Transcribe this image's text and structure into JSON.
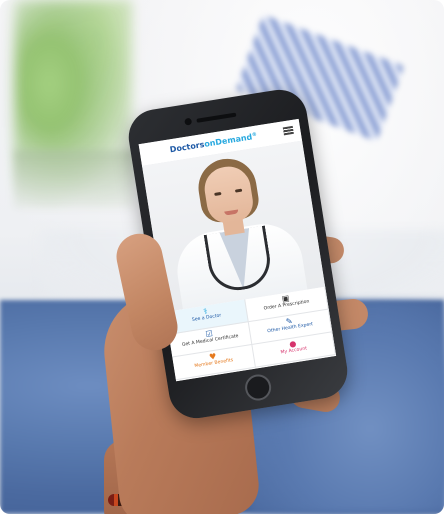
{
  "app": {
    "logo_part1": "Doctors",
    "logo_part2": "onDemand",
    "logo_mark": "®"
  },
  "menu": [
    {
      "label": "See a Doctor",
      "icon": "stethoscope-icon",
      "color": "#1f5aa6"
    },
    {
      "label": "Order A Prescription",
      "icon": "prescription-icon",
      "color": "#333333"
    },
    {
      "label": "Get A Medical Certificate",
      "icon": "certificate-icon",
      "color": "#333333"
    },
    {
      "label": "Other Health Expert",
      "icon": "expert-icon",
      "color": "#1f5aa6"
    },
    {
      "label": "Member Benefits",
      "icon": "heart-icon",
      "color": "#e57a1f"
    },
    {
      "label": "My Account",
      "icon": "account-icon",
      "color": "#d6336c"
    }
  ],
  "colors": {
    "brand_dark": "#1f5aa6",
    "brand_light": "#28a9df",
    "couch": "#5879ae"
  }
}
